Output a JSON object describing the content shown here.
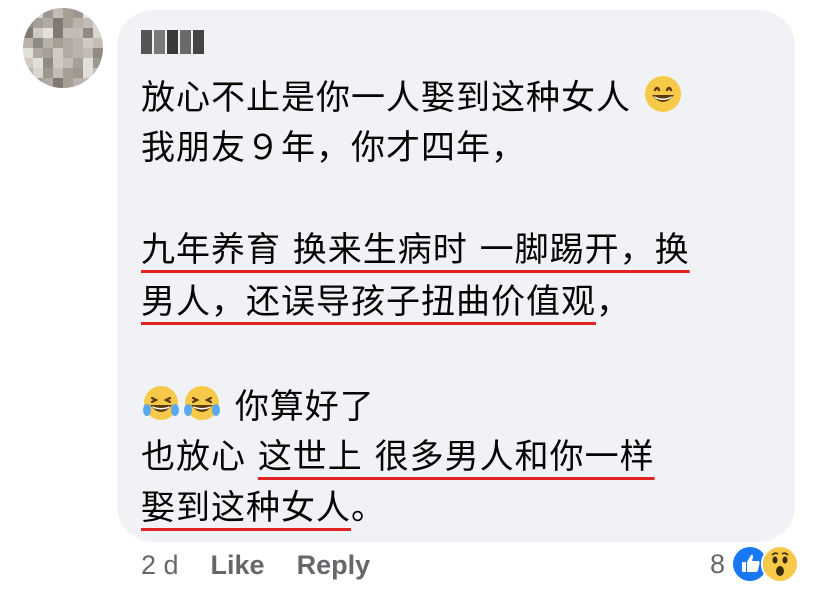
{
  "comment": {
    "lines": [
      {
        "text": "放心不止是你一人娶到这种女人",
        "emoji": "grinning-face"
      },
      {
        "text": "我朋友９年，你才四年，"
      },
      {
        "segments": [
          {
            "text": "九年养育 换来生病时 一脚踢开，换",
            "u": true
          }
        ]
      },
      {
        "segments": [
          {
            "text": "男人，还误导孩子扭曲价值观",
            "u": true
          },
          {
            "text": "，",
            "u": false
          }
        ]
      },
      {
        "text": "你算好了",
        "emoji": "laughing-tears-pair"
      },
      {
        "segments": [
          {
            "text": "也放心 ",
            "u": false
          },
          {
            "text": "这世上 很多男人和你一样",
            "u": true
          }
        ]
      },
      {
        "segments": [
          {
            "text": "娶到这种女人",
            "u": true
          },
          {
            "text": "。",
            "u": false
          }
        ]
      }
    ]
  },
  "footer": {
    "time": "2 d",
    "like_label": "Like",
    "reply_label": "Reply",
    "reaction_count": "8"
  },
  "icons": [
    "avatar-blurred",
    "grinning-face-icon",
    "laughing-tears-icon",
    "like-reaction-icon",
    "wow-reaction-icon"
  ],
  "colors": {
    "bubble": "#f0f2f5",
    "underline": "#e02424",
    "meta": "#65676b",
    "like_blue": "#1877f2",
    "wow_yellow": "#f7c948"
  }
}
